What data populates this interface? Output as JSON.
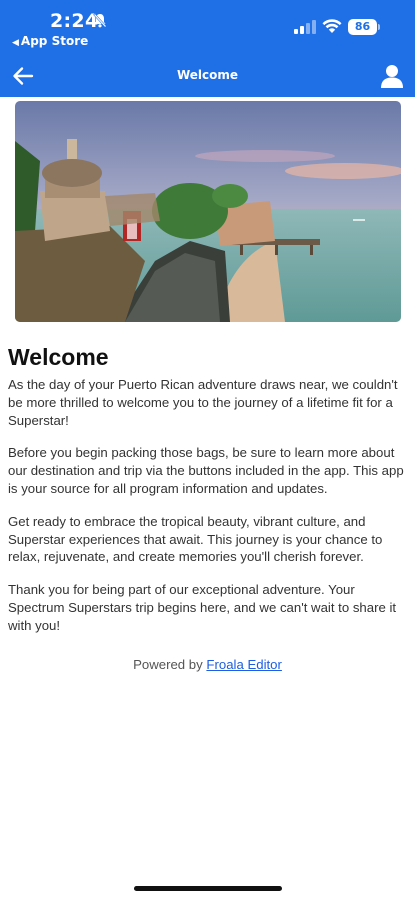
{
  "status_bar": {
    "time": "2:24",
    "back_app": "App Store",
    "battery": "86"
  },
  "nav": {
    "title": "Welcome"
  },
  "content": {
    "heading": "Welcome",
    "paragraphs": [
      "As the day of your Puerto Rican adventure draws near, we couldn't be more thrilled to welcome you to the journey of a lifetime fit for a Superstar!",
      "Before you begin packing those bags, be sure to learn more about our destination and trip via the buttons included in the app. This app is your source for all program information and updates.",
      "Get ready to embrace the tropical beauty, vibrant culture, and Superstar experiences that await. This journey is your chance to relax, rejuvenate, and create memories you'll cherish forever.",
      "Thank you for being part of our exceptional adventure. Your Spectrum Superstars trip begins here, and we can't wait to share it with you!"
    ]
  },
  "footer": {
    "powered_by": "Powered by",
    "link": "Froala Editor"
  },
  "colors": {
    "header_bg": "#1f6fe6",
    "link": "#1e5ee0",
    "text": "#333333"
  },
  "icons": {
    "back": "arrow-left-icon",
    "profile": "user-icon",
    "bell": "bell-slash-icon",
    "signal": "cellular-signal-icon",
    "wifi": "wifi-icon"
  }
}
